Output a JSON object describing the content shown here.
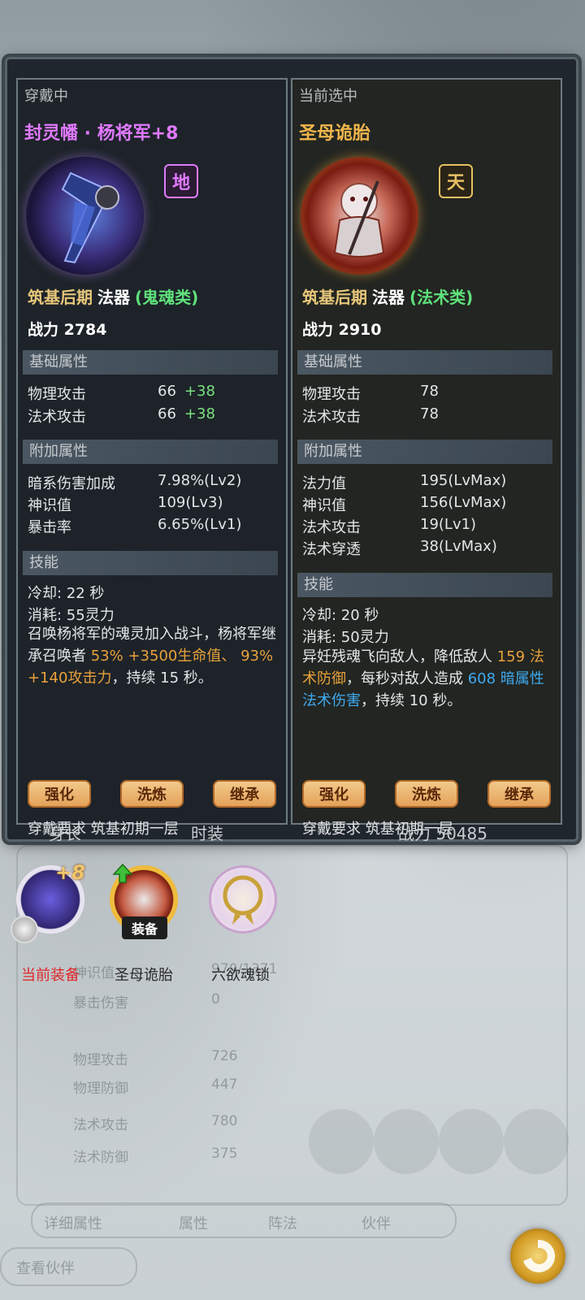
{
  "left_panel": {
    "tag": "穿戴中",
    "name": "封灵幡 · 杨将军+8",
    "name_color": "#e079ff",
    "grade": "地",
    "realm": "筑基后期",
    "kind": "法器",
    "category": "(鬼魂类)",
    "power": "战力 2784",
    "base_title": "基础属性",
    "base_stats": [
      {
        "label": "物理攻击",
        "value": "66",
        "bonus": "+38"
      },
      {
        "label": "法术攻击",
        "value": "66",
        "bonus": "+38"
      }
    ],
    "extra_title": "附加属性",
    "extra_stats": [
      {
        "label": "暗系伤害加成",
        "value": "7.98%(Lv2)"
      },
      {
        "label": "神识值",
        "value": "109(Lv3)"
      },
      {
        "label": "暴击率",
        "value": "6.65%(Lv1)"
      }
    ],
    "skill_title": "技能",
    "cooldown": "冷却:  22 秒",
    "cost": "消耗:  55灵力",
    "desc_1": "召唤杨将军的魂灵加入战斗，杨将军继承召唤者 ",
    "desc_hl1": "53% +3500生命值、 93% +140攻击力",
    "desc_2": "，持续  15  秒。",
    "buttons": [
      "强化",
      "洗炼",
      "继承"
    ],
    "requirement": "穿戴要求  筑基初期一层"
  },
  "right_panel": {
    "tag": "当前选中",
    "name": "圣母诡胎",
    "name_color": "#f0b64c",
    "grade": "天",
    "realm": "筑基后期",
    "kind": "法器",
    "category": "(法术类)",
    "power": "战力 2910",
    "base_title": "基础属性",
    "base_stats": [
      {
        "label": "物理攻击",
        "value": "78"
      },
      {
        "label": "法术攻击",
        "value": "78"
      }
    ],
    "extra_title": "附加属性",
    "extra_stats": [
      {
        "label": "法力值",
        "value": "195(LvMax)"
      },
      {
        "label": "神识值",
        "value": "156(LvMax)"
      },
      {
        "label": "法术攻击",
        "value": "19(Lv1)"
      },
      {
        "label": "法术穿透",
        "value": "38(LvMax)"
      }
    ],
    "skill_title": "技能",
    "cooldown": "冷却:  20 秒",
    "cost": "消耗:  50灵力",
    "desc_1": "异妊残魂飞向敌人，降低敌人 ",
    "desc_hl1": "159  法术防御",
    "desc_2": "，每秒对敌人造成 ",
    "desc_hl2": "608  暗属性法术伤害",
    "desc_3": "，持续  10  秒。",
    "buttons": [
      "强化",
      "洗炼",
      "继承"
    ],
    "requirement": "穿戴要求  筑基初期一层"
  },
  "band": {
    "left_text": "身长",
    "mid_text": "时装",
    "right_text": "战力 50485"
  },
  "slots": [
    {
      "label": "当前装备",
      "badge": "+8",
      "label_color": "#e0282a"
    },
    {
      "label": "圣母诡胎",
      "tag": "装备",
      "label_color": "#2a2a2a"
    },
    {
      "label": "六欲魂锁",
      "label_color": "#2a2a2a"
    }
  ],
  "background_page": {
    "rows": [
      "神识值",
      "暴击伤害",
      "物理攻击",
      "物理防御",
      "法术攻击",
      "法术防御"
    ],
    "values": [
      "970/1371",
      "0",
      "726",
      "447",
      "780",
      "375"
    ],
    "tabs": [
      "详细属性",
      "属性",
      "阵法",
      "伙伴"
    ],
    "bottom_button": "查看伙伴"
  }
}
